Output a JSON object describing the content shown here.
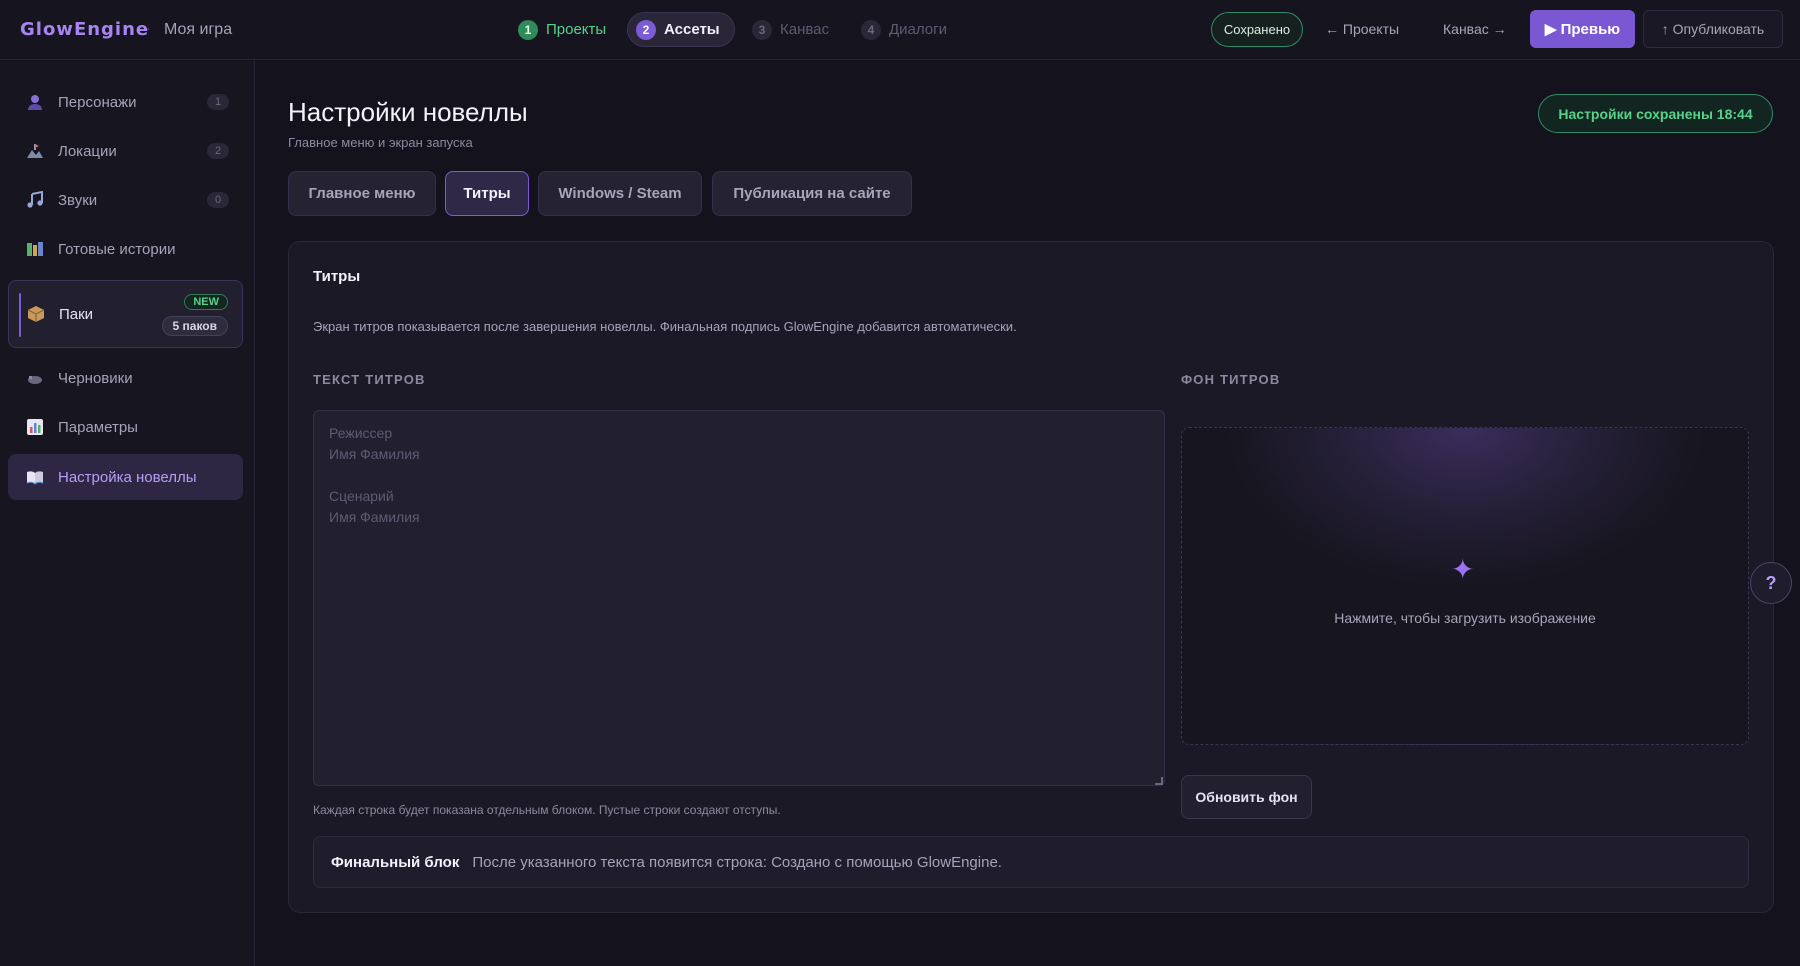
{
  "header": {
    "brand": "GlowEngine",
    "separator": "·",
    "project": "Моя игра",
    "steps": [
      {
        "num": "1",
        "label": "Проекты"
      },
      {
        "num": "2",
        "label": "Ассеты"
      },
      {
        "num": "3",
        "label": "Канвас"
      },
      {
        "num": "4",
        "label": "Диалоги"
      }
    ],
    "saved": "Сохранено",
    "back": "← Проекты",
    "forward": "Канвас →",
    "preview": "▶ Превью",
    "publish": "↑ Опубликовать"
  },
  "sidebar": {
    "items": [
      {
        "label": "Персонажи",
        "count": "1",
        "icon": "person-icon"
      },
      {
        "label": "Локации",
        "count": "2",
        "icon": "location-icon"
      },
      {
        "label": "Звуки",
        "count": "0",
        "icon": "music-note-icon"
      },
      {
        "label": "Готовые истории",
        "icon": "books-icon"
      },
      {
        "label": "Паки",
        "badge": "NEW",
        "packs_count": "5 паков",
        "icon": "package-icon"
      },
      {
        "label": "Черновики",
        "icon": "drafts-icon"
      },
      {
        "label": "Параметры",
        "icon": "chart-icon"
      },
      {
        "label": "Настройка новеллы",
        "icon": "book-icon"
      }
    ]
  },
  "main": {
    "title": "Настройки новеллы",
    "subtitle": "Главное меню и экран запуска",
    "saved_toast": "Настройки сохранены 18:44",
    "tabs": [
      {
        "label": "Главное меню"
      },
      {
        "label": "Титры",
        "active": true
      },
      {
        "label": "Windows / Steam"
      },
      {
        "label": "Публикация на сайте"
      }
    ],
    "card": {
      "title": "Титры",
      "description": "Экран титров показывается после завершения новеллы. Финальная подпись GlowEngine добавится автоматически.",
      "text_label": "ТЕКСТ ТИТРОВ",
      "bg_label": "ФОН ТИТРОВ",
      "textarea_value": "",
      "textarea_placeholder": "Режиссер\nИмя Фамилия\n\nСценарий\nИмя Фамилия",
      "hint": "Каждая строка будет показана отдельным блоком. Пустые строки создают отступы.",
      "upload_icon": "✦",
      "upload_text": "Нажмите, чтобы загрузить изображение",
      "update_bg": "Обновить фон",
      "final_title": "Финальный блок",
      "final_text": "После указанного текста появится строка: Создано с помощью GlowEngine."
    },
    "help": "?"
  },
  "colors": {
    "accent": "#7b58d3",
    "success": "#57d28a",
    "background": "#14121d"
  }
}
